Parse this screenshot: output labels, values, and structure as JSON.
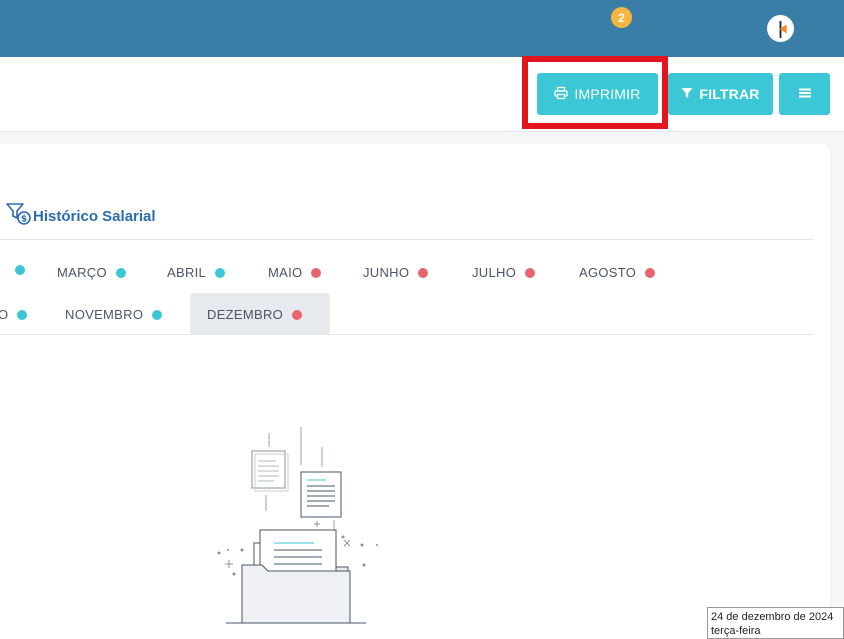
{
  "topbar": {
    "notification_count": "2",
    "icons": [
      "bell-icon",
      "gear-icon",
      "help-icon",
      "avatar",
      "chevron-down-icon"
    ],
    "color": "#3a7ea7"
  },
  "actions": {
    "print_label": "IMPRIMIR",
    "filter_label": "FILTRAR",
    "button_color": "#3cc7d6"
  },
  "section": {
    "title": "Histórico Salarial"
  },
  "months_row1": [
    {
      "label": "",
      "status": "teal"
    },
    {
      "label": "MARÇO",
      "status": "teal"
    },
    {
      "label": "ABRIL",
      "status": "teal"
    },
    {
      "label": "MAIO",
      "status": "red"
    },
    {
      "label": "JUNHO",
      "status": "red"
    },
    {
      "label": "JULHO",
      "status": "red"
    },
    {
      "label": "AGOSTO",
      "status": "red"
    }
  ],
  "months_row2": [
    {
      "label": "O",
      "status": "teal"
    },
    {
      "label": "NOVEMBRO",
      "status": "teal"
    },
    {
      "label": "DEZEMBRO",
      "status": "red",
      "active": true
    }
  ],
  "tooltip": {
    "date": "24 de dezembro de 2024",
    "weekday": "terça-feira"
  }
}
